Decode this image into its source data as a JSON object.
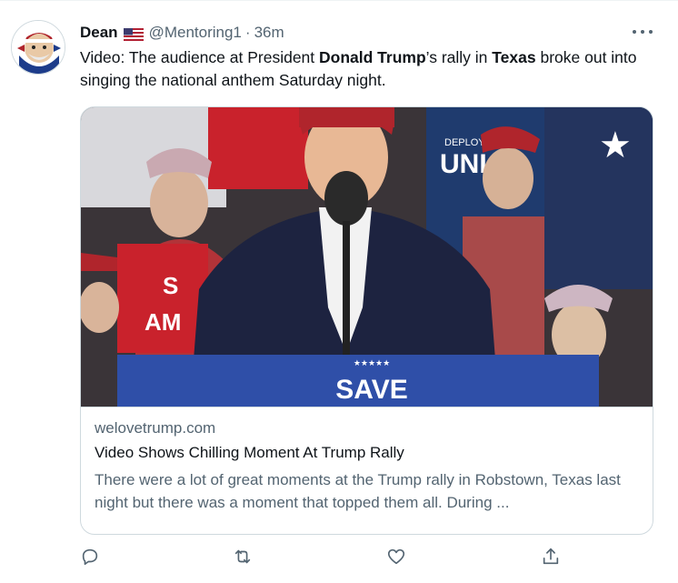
{
  "tweet": {
    "author_name": "Dean",
    "handle": "@Mentoring1",
    "separator": "·",
    "time": "36m",
    "text_parts": {
      "p1": "Video: The audience at President ",
      "b1": "Donald Trump",
      "p2": "’s rally in ",
      "b2": "Texas",
      "p3": " broke out into singing the national anthem Saturday night."
    },
    "icons": {
      "more": "more-icon",
      "flag": "us-flag-icon",
      "reply": "reply-icon",
      "retweet": "retweet-icon",
      "like": "heart-icon",
      "share": "share-icon"
    }
  },
  "card": {
    "domain": "welovetrump.com",
    "title": "Video Shows Chilling Moment At Trump Rally",
    "description": "There were a lot of great moments at the Trump rally in Robstown, Texas last night but there was a moment that topped them all. During ...",
    "image_sign_text": "SAVE",
    "image_banner_text": "UNI",
    "image_banner_small": "DEPLOY",
    "image_stars": "★★★★★"
  },
  "colors": {
    "text": "#0f1419",
    "secondary": "#536471",
    "border": "#cfd9de",
    "sign_blue": "#2f4fa8",
    "hat_red": "#b0252c"
  }
}
